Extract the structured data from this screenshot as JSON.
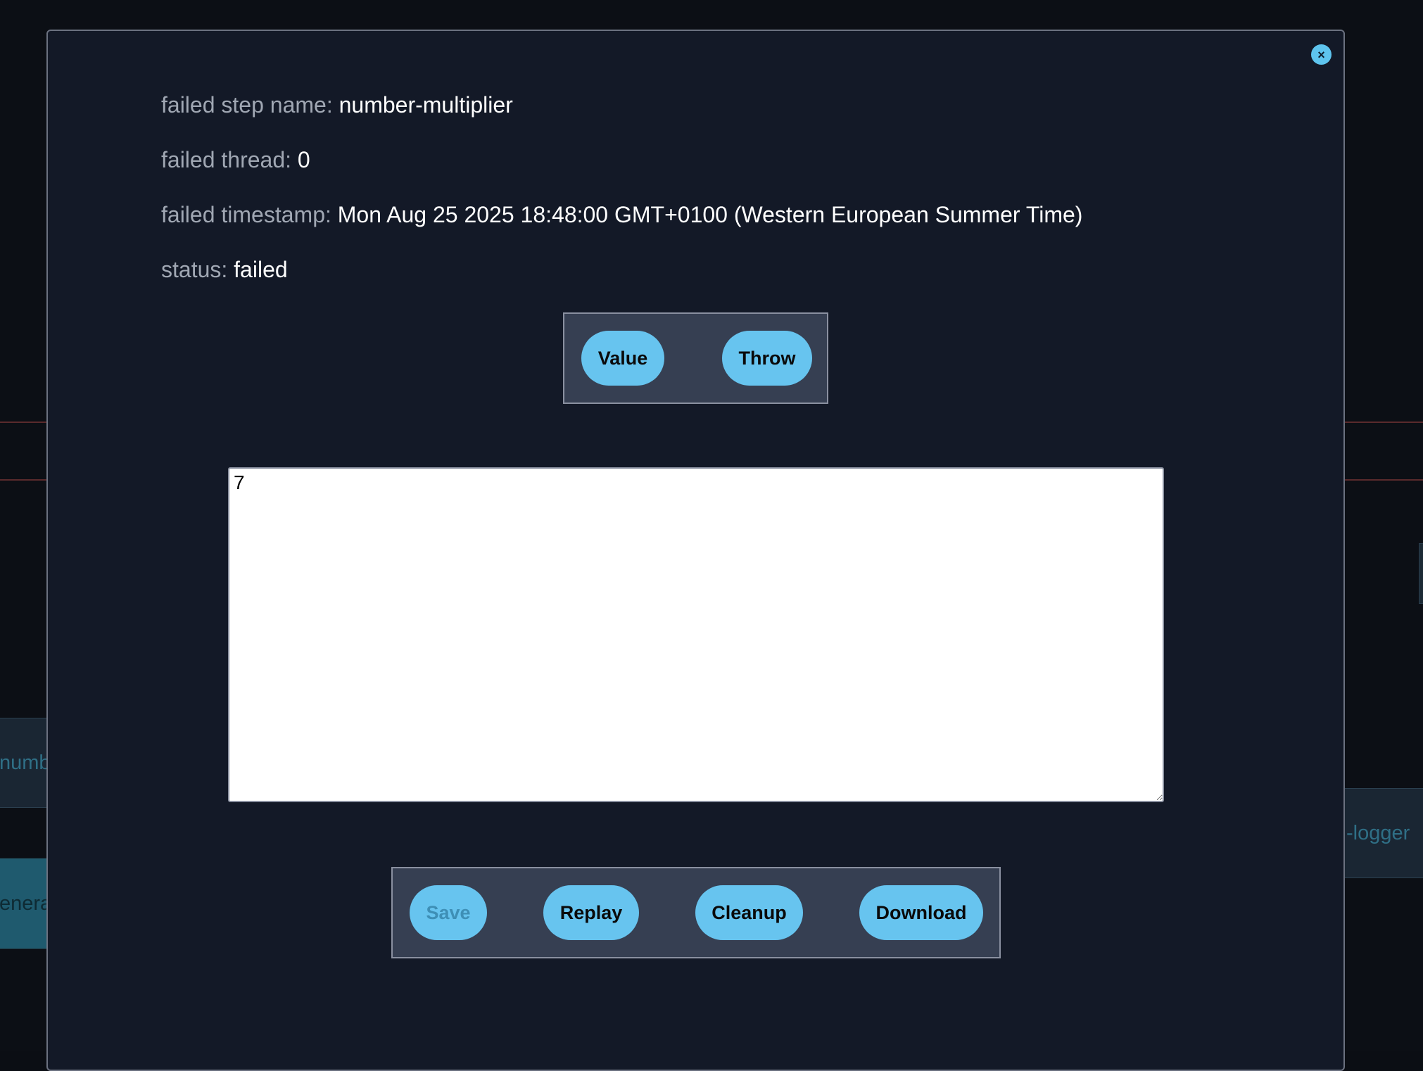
{
  "background": {
    "node_left_partial": "numb",
    "node_teal_partial": "enera",
    "node_right_partial": "-logger"
  },
  "modal": {
    "close_label": "×",
    "info": {
      "step_name_label": "failed step name:",
      "step_name_value": "number-multiplier",
      "thread_label": "failed thread:",
      "thread_value": "0",
      "timestamp_label": "failed timestamp:",
      "timestamp_value": "Mon Aug 25 2025 18:48:00 GMT+0100 (Western European Summer Time)",
      "status_label": "status:",
      "status_value": "failed"
    },
    "mode_buttons": {
      "value_label": "Value",
      "throw_label": "Throw"
    },
    "editor": {
      "content": "7"
    },
    "actions": {
      "save_label": "Save",
      "replay_label": "Replay",
      "cleanup_label": "Cleanup",
      "download_label": "Download"
    }
  },
  "colors": {
    "accent": "#67c4ef",
    "modal_bg": "#131927",
    "button_group_bg": "#363f52"
  }
}
